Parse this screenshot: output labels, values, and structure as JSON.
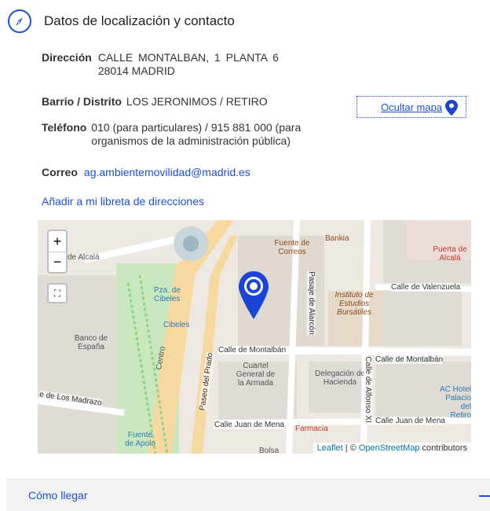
{
  "section": {
    "title": "Datos de localización y contacto",
    "icon": "compass-icon"
  },
  "address": {
    "label": "Dirección",
    "line1": "CALLE MONTALBAN, 1 PLANTA 6",
    "line2": "28014 MADRID"
  },
  "district": {
    "label": "Barrio / Distrito",
    "value": "LOS JERONIMOS / RETIRO"
  },
  "phone": {
    "label": "Teléfono",
    "value": "010 (para particulares) / 915 881 000 (para organismos de la administración pública)"
  },
  "email": {
    "label": "Correo",
    "value": "ag.ambientemovilidad@madrid.es"
  },
  "address_book_link": "Añadir a mi libreta de direcciones",
  "map_toggle": {
    "label": "Ocultar mapa",
    "icon": "map-pin-icon"
  },
  "map": {
    "zoom_in": "+",
    "zoom_out": "−",
    "attribution_leaflet": "Leaflet",
    "attribution_sep": " | © ",
    "attribution_osm": "OpenStreetMap",
    "attribution_rest": " contributors",
    "labels": {
      "calle_alcala": "de Alcalá",
      "banco": "Banco de España",
      "pza_cibeles": "Pza. de Cibeles",
      "cibeles": "Cibeles",
      "centro": "Centro",
      "paseo_prado": "Paseo del Prado",
      "fuente_correos": "Fuente de Correos",
      "bankia": "Bankia",
      "pasaje_alarcon": "Pasaje de Alarcón",
      "instituto": "Instituto de Estudios Bursátiles",
      "calle_valenzuela": "Calle de Valenzuela",
      "puerta_alcala": "Puerta de Alcalá",
      "calle_montalban": "Calle de Montalbán",
      "cuartel": "Cuartel General de la Armada",
      "delegacion": "Delegación de Hacienda",
      "calle_alfonso": "Calle de Alfonso XI",
      "calle_madrazo": "e de Los Madrazo",
      "calle_juan_mena": "Calle Juan de Mena",
      "farmacia": "Farmacia",
      "fuente_apolo": "Fuente de Apolo",
      "ac_hotel": "AC Hotel Palacio del Retiro",
      "bolsa": "Bolsa"
    }
  },
  "accordion": {
    "title": "Cómo llegar"
  },
  "colors": {
    "link": "#1e4fd6",
    "marker": "#1a44d6"
  }
}
